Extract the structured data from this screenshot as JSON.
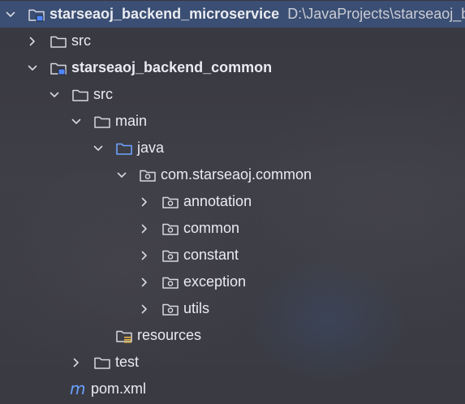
{
  "colors": {
    "selection": "#3c5482",
    "text": "#e9ebf0",
    "path_text": "#c9ccd4",
    "icon_stroke": "#d7d9df",
    "source_folder_blue": "#6fa3ff",
    "module_marker_blue": "#4e86ff",
    "resources_marker": "#e3b341",
    "maven_blue": "#6aa0ff"
  },
  "tree": {
    "items": [
      {
        "label": "starseaoj_backend_microservice",
        "path": "D:\\JavaProjects\\starseaoj_b",
        "expanded": true,
        "icon": "module-folder-icon",
        "bold": true,
        "selected": true
      },
      {
        "label": "src",
        "expanded": false,
        "icon": "folder-icon"
      },
      {
        "label": "starseaoj_backend_common",
        "expanded": true,
        "icon": "module-folder-icon",
        "bold": true
      },
      {
        "label": "src",
        "expanded": true,
        "icon": "folder-icon"
      },
      {
        "label": "main",
        "expanded": true,
        "icon": "folder-icon"
      },
      {
        "label": "java",
        "expanded": true,
        "icon": "source-root-folder-icon"
      },
      {
        "label": "com.starseaoj.common",
        "expanded": true,
        "icon": "package-icon"
      },
      {
        "label": "annotation",
        "expanded": false,
        "icon": "package-icon"
      },
      {
        "label": "common",
        "expanded": false,
        "icon": "package-icon"
      },
      {
        "label": "constant",
        "expanded": false,
        "icon": "package-icon"
      },
      {
        "label": "exception",
        "expanded": false,
        "icon": "package-icon"
      },
      {
        "label": "utils",
        "expanded": false,
        "icon": "package-icon"
      },
      {
        "label": "resources",
        "icon": "resources-folder-icon"
      },
      {
        "label": "test",
        "expanded": false,
        "icon": "folder-icon"
      },
      {
        "label": "pom.xml",
        "icon": "maven-icon"
      }
    ]
  }
}
